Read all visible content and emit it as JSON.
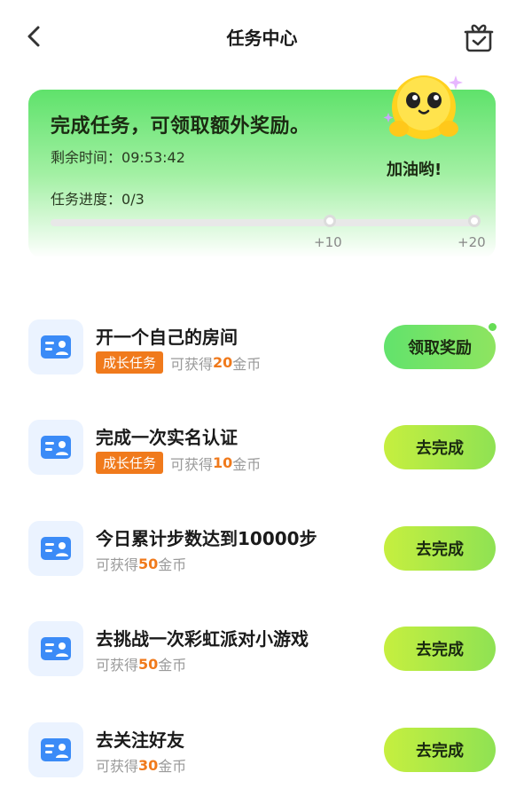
{
  "header": {
    "title": "任务中心"
  },
  "banner": {
    "title": "完成任务，可领取额外奖励。",
    "time_label": "剩余时间：",
    "time_value": "09:53:42",
    "progress_label": "任务进度：",
    "progress_value": "0/3",
    "cheer": "加油哟!",
    "progress_fraction": 0,
    "milestones": [
      "+10",
      "+20"
    ]
  },
  "tasks": [
    {
      "title": "开一个自己的房间",
      "badge": "成长任务",
      "reward_prefix": "可获得",
      "coins": "20",
      "reward_suffix": "金币",
      "button": "领取奖励"
    },
    {
      "title": "完成一次实名认证",
      "badge": "成长任务",
      "reward_prefix": "可获得",
      "coins": "10",
      "reward_suffix": "金币",
      "button": "去完成"
    },
    {
      "title": "今日累计步数达到10000步",
      "reward_prefix": "可获得",
      "coins": "50",
      "reward_suffix": "金币",
      "button": "去完成"
    },
    {
      "title": "去挑战一次彩虹派对小游戏",
      "reward_prefix": "可获得",
      "coins": "50",
      "reward_suffix": "金币",
      "button": "去完成"
    },
    {
      "title": "去关注好友",
      "reward_prefix": "可获得",
      "coins": "30",
      "reward_suffix": "金币",
      "button": "去完成"
    }
  ],
  "colors": {
    "accent_green": "#5fe26b",
    "badge_orange": "#f07a1c",
    "button_lime": "#c6ef3f"
  }
}
